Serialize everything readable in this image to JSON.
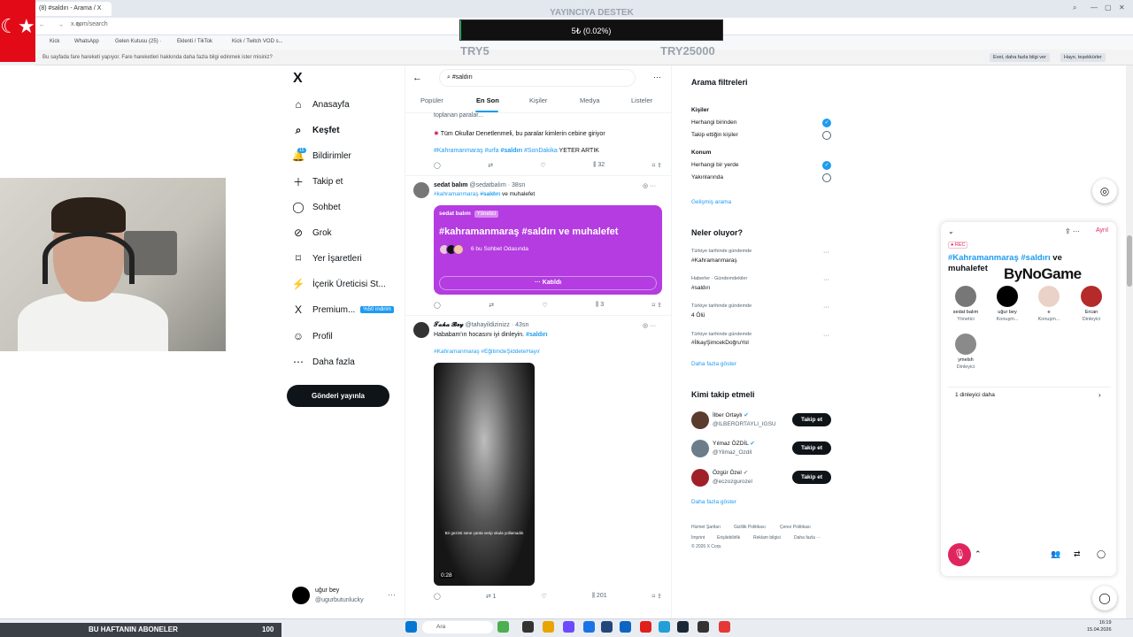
{
  "browser": {
    "tab_title": "(8) #saldırı - Arama / X",
    "address": "x.com/search",
    "bookmarks": [
      "Kick",
      "WhatsApp",
      "Gelen Kutusu (25) ·",
      "Eklenti / TikTok",
      "Kick / Twitch VOD s..."
    ],
    "info_text": "Bu sayfada fare hareketi yapıyor. Fare hareketleri hakkında daha fazla bilgi edinmek ister misiniz?",
    "info_buttons": [
      "Evet, daha fazla bilgi ver",
      "Hayır, teşekkürler"
    ],
    "brand_glyph": "☾★"
  },
  "donation": {
    "title": "YAYINCIYA DESTEK",
    "amount": "5₺ (0.02%)",
    "progress_percent": 0.02,
    "min": "TRY5",
    "max": "TRY25000",
    "fill_color": "#2dd36f"
  },
  "nav": {
    "logo": "X",
    "items": [
      {
        "label": "Anasayfa",
        "icon": "⌂"
      },
      {
        "label": "Keşfet",
        "icon": "⌕"
      },
      {
        "label": "Bildirimler",
        "icon": "🔔"
      },
      {
        "label": "Takip et",
        "icon": "＋"
      },
      {
        "label": "Sohbet",
        "icon": "◯"
      },
      {
        "label": "Grok",
        "icon": "⊘"
      },
      {
        "label": "Yer İşaretleri",
        "icon": "⌑"
      },
      {
        "label": "İçerik Üreticisi St...",
        "icon": "⚡"
      },
      {
        "label": "Premium...",
        "icon": "X"
      },
      {
        "label": "Profil",
        "icon": "☺"
      },
      {
        "label": "Daha fazla",
        "icon": "⋯"
      }
    ],
    "premium_badge": "%50 indirim",
    "notification_count": "15",
    "post_button": "Gönderi yayınla",
    "user": {
      "name": "uğur bey",
      "handle": "@ugurbutunlucky"
    }
  },
  "search": {
    "query": "#saldırı",
    "tabs": [
      "Popüler",
      "En Son",
      "Kişiler",
      "Medya",
      "Listeler"
    ],
    "active_tab": "En Son"
  },
  "feed": {
    "post1": {
      "partial_text": "toplanan paralar...",
      "line2": "Tüm Okullar Denetlenmeli, bu paralar kimlerin cebine giriyor",
      "tags_prefix": "#Kahramanmaraş #urfa",
      "tag_bold": "#saldırı",
      "tags_suffix": "#SonDakika",
      "tail": "YETER ARTIK",
      "views": "32"
    },
    "post2": {
      "name": "sedat balım",
      "handle": "@sedatbalım · 38sn",
      "text_tags": "#kahramanmaraş",
      "text_bold": "#saldırı",
      "text_tail": "ve muhalefet",
      "space_host": "sedat balım",
      "space_host_badge": "Yönetici",
      "space_title": "#kahramanmaraş #saldırı ve muhalefet",
      "space_listeners": "6 bu Sohbet Odasında",
      "space_join": "Katıldı",
      "views": "3"
    },
    "post3": {
      "name": "𝓣𝓪𝓱𝓪 𝓑𝓮𝔂",
      "handle": "@tahayildizinizz · 43sn",
      "text": "Hababam'ın hocasını iyi dinleyin.",
      "text_tag": "#saldırı",
      "tags": "#Kahramanmaraş #EğitimdeŞiddeteHayır",
      "video_caption": "Bir gezinti süne çanta verip okula yollamadık",
      "video_time": "0:28",
      "retweets": "1",
      "views": "201"
    }
  },
  "filters": {
    "title": "Arama filtreleri",
    "people_label": "Kişiler",
    "people_options": [
      "Herhangi birinden",
      "Takip ettiğin kişiler"
    ],
    "location_label": "Konum",
    "location_options": [
      "Herhangi bir yerde",
      "Yakınlarında"
    ],
    "advanced_link": "Gelişmiş arama"
  },
  "trends": {
    "title": "Neler oluyor?",
    "items": [
      {
        "context": "Türkiye tarihinde gündemde",
        "name": "#Kahramanmaraş"
      },
      {
        "context": "Haberler · Gündemdekiler",
        "name": "#saldırı"
      },
      {
        "context": "Türkiye tarihinde gündemde",
        "name": "4 Ölü"
      },
      {
        "context": "Türkiye tarihinde gündemde",
        "name": "#İlkayŞimcekDoğruYol"
      }
    ],
    "more_link": "Daha fazla göster"
  },
  "who_to_follow": {
    "title": "Kimi takip etmeli",
    "users": [
      {
        "name": "İlber Ortaylı",
        "handle": "@ILBERORTAYLI_IGSU"
      },
      {
        "name": "Yılmaz ÖZDİL",
        "handle": "@Yilmaz_Ozdil"
      },
      {
        "name": "Özgür Özel",
        "handle": "@eczozgurozel"
      }
    ],
    "follow_label": "Takip et",
    "more_link": "Daha fazla göster"
  },
  "footer": {
    "links": [
      "Hizmet Şartları",
      "Gizlilik Politikası",
      "Çerez Politikası",
      "İmprint",
      "Erişilebilirlik",
      "Reklam bilgisi",
      "Daha fazla ···"
    ],
    "copyright": "© 2026 X Corp."
  },
  "space_panel": {
    "rec": "● REC",
    "leave": "Ayrıl",
    "title_tags": "#Kahramanmaraş #saldırı",
    "title_tail": "ve muhalefet",
    "participants": [
      {
        "name": "sedat balım",
        "role": "Yönetici"
      },
      {
        "name": "uğur bey",
        "role": "Konuşm..."
      },
      {
        "name": "e",
        "role": "Konuşm..."
      },
      {
        "name": "Ercan",
        "role": "Dinleyici"
      },
      {
        "name": "ymelsh",
        "role": "Dinleyici"
      }
    ],
    "more_listeners": "1 dinleyici daha"
  },
  "overlay_brand": "ByNoGame",
  "taskbar": {
    "sub_label": "BU HAFTANIN ABONELER",
    "sub_count": "100",
    "search": "Ara",
    "time": "16:19",
    "date": "15.04.2026"
  }
}
